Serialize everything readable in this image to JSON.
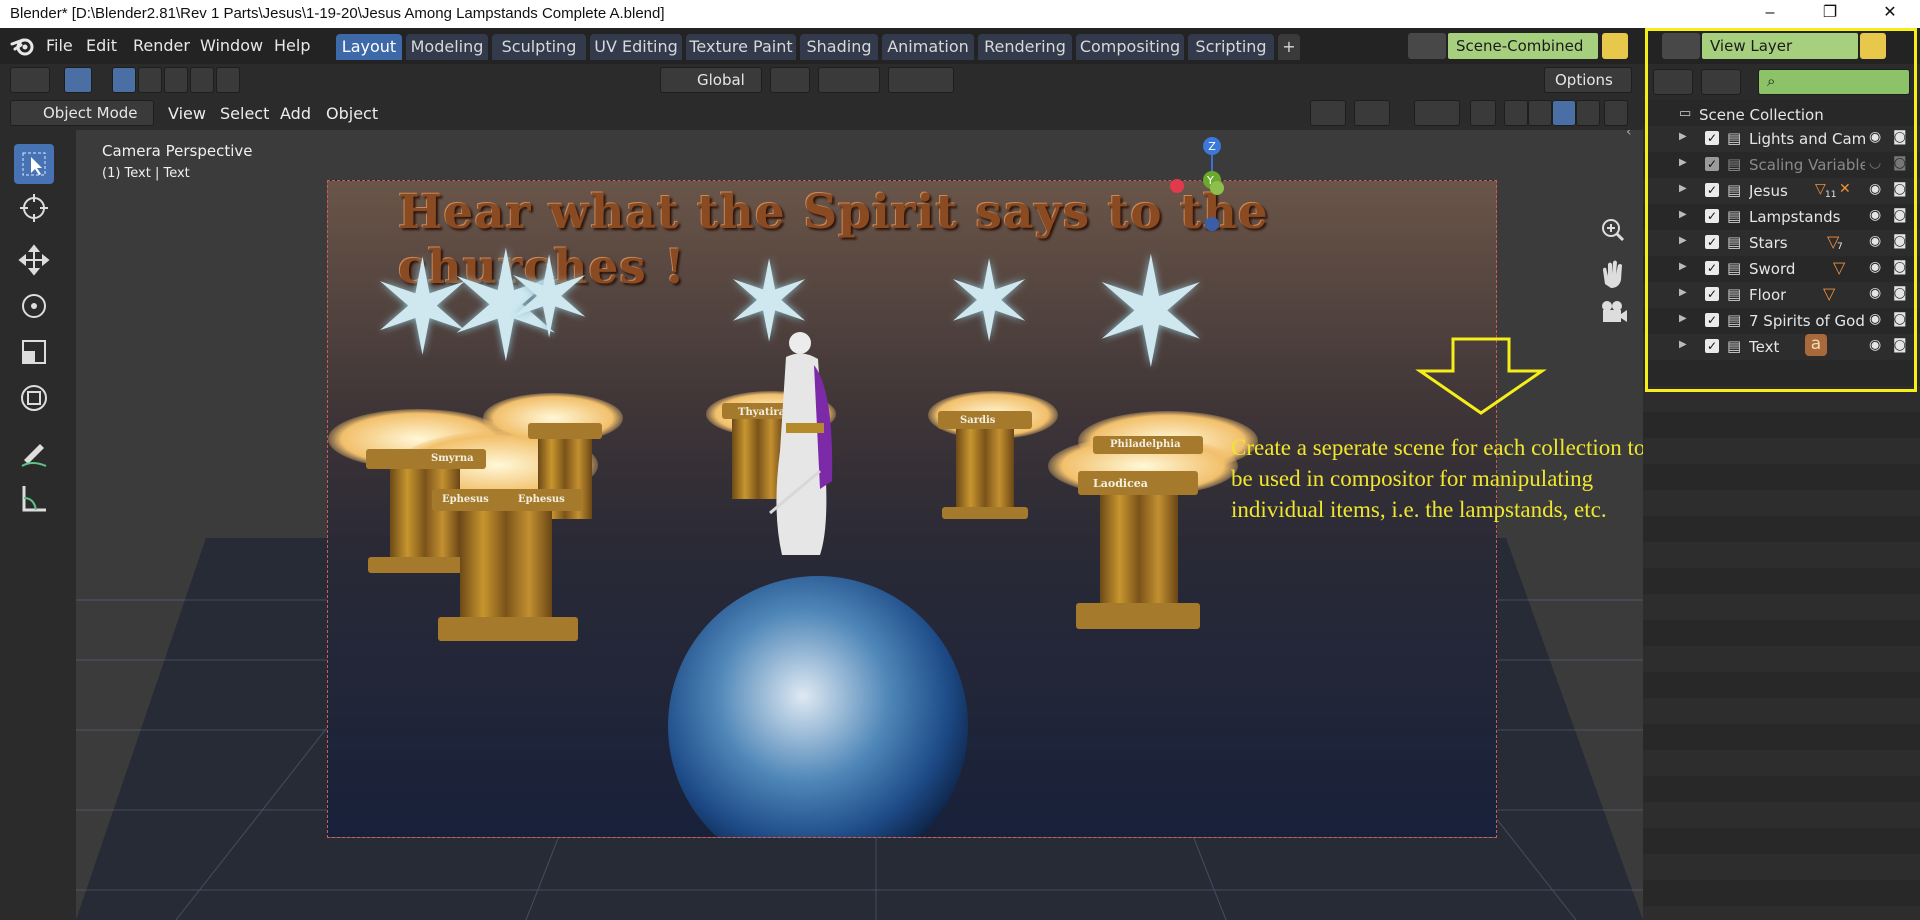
{
  "window": {
    "title": "Blender* [D:\\Blender2.81\\Rev 1 Parts\\Jesus\\1-19-20\\Jesus Among Lampstands Complete A.blend]",
    "minimize": "–",
    "maximize": "❐",
    "close": "✕"
  },
  "menubar": [
    "File",
    "Edit",
    "Render",
    "Window",
    "Help"
  ],
  "workspaces": [
    "Layout",
    "Modeling",
    "Sculpting",
    "UV Editing",
    "Texture Paint",
    "Shading",
    "Animation",
    "Rendering",
    "Compositing",
    "Scripting"
  ],
  "add_workspace": "+",
  "scene": {
    "name": "Scene-Combined"
  },
  "view_layer": {
    "name": "View Layer"
  },
  "header": {
    "transform_orientation": "Global",
    "options_label": "Options",
    "mode": "Object Mode",
    "menus": [
      "View",
      "Select",
      "Add",
      "Object"
    ]
  },
  "viewport": {
    "camera_label": "Camera Perspective",
    "object_label": "(1) Text | Text",
    "axes": {
      "z": "Z",
      "y": "Y"
    }
  },
  "render": {
    "headline": "Hear what the Spirit says to the churches !",
    "pillar_labels": [
      "Smyrna",
      "Ephesus",
      "Ephesus",
      "Thyatira",
      "Sardis",
      "Laodicea",
      "Philadelphia"
    ]
  },
  "annotation": "Create a seperate scene for each collection to be used in compositor for manipulating individual items, i.e. the lampstands, etc.",
  "outliner": {
    "root": "Scene Collection",
    "collections": [
      {
        "name": "Lights and Cam",
        "badge": ""
      },
      {
        "name": "Scaling Variable",
        "badge": ""
      },
      {
        "name": "Jesus",
        "badge": "11"
      },
      {
        "name": "Lampstands",
        "badge": ""
      },
      {
        "name": "Stars",
        "badge": "7"
      },
      {
        "name": "Sword",
        "badge": ""
      },
      {
        "name": "Floor",
        "badge": ""
      },
      {
        "name": "7 Spirits of God",
        "badge": ""
      },
      {
        "name": "Text",
        "badge": ""
      }
    ]
  },
  "colors": {
    "active_tab": "#3d69a8",
    "highlight_box": "#f5ee1a",
    "annotation_text": "#f0e62e",
    "scene_field": "#a7d07e"
  }
}
